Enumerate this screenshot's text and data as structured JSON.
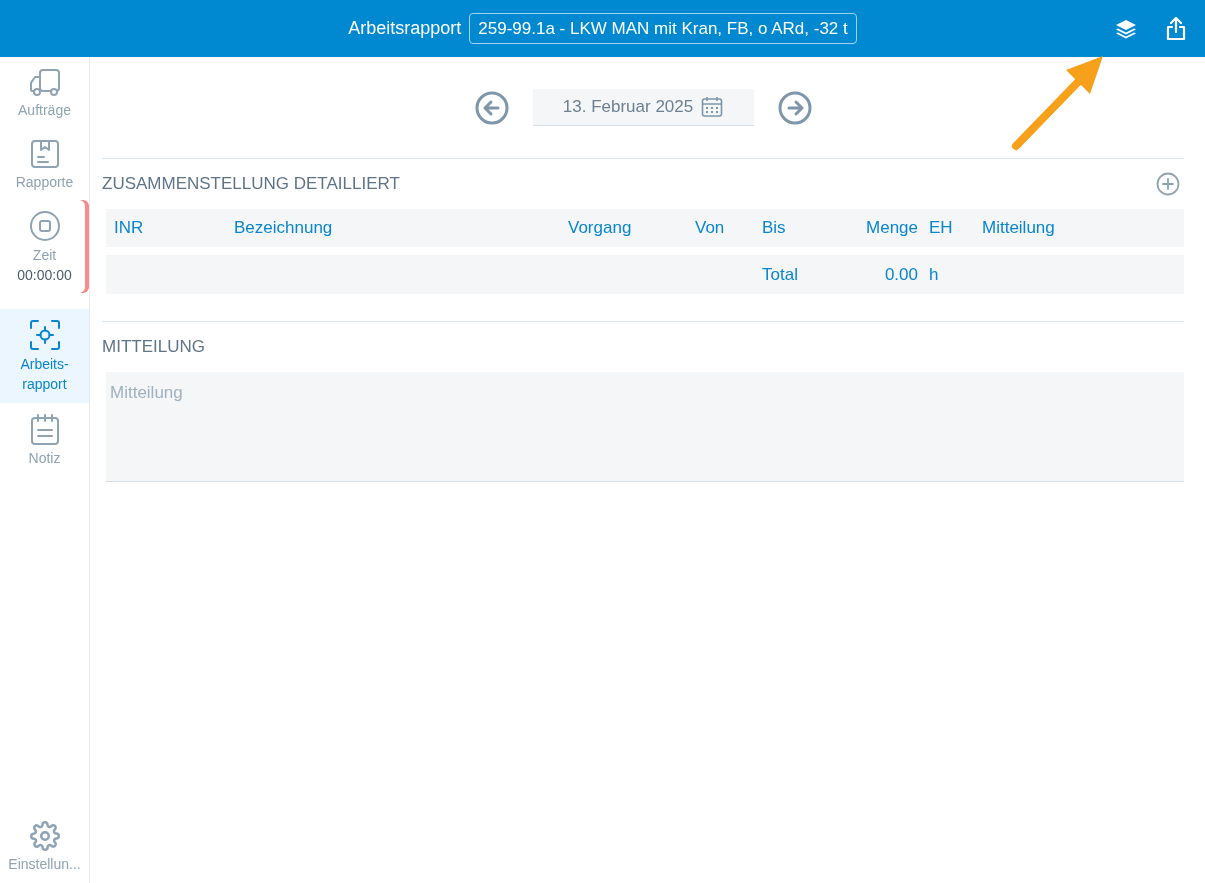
{
  "header": {
    "title": "Arbeitsrapport",
    "selector_value": "259-99.1a - LKW MAN mit Kran, FB, o ARd, -32 t"
  },
  "sidebar": {
    "items": [
      {
        "kind": "truck",
        "label": "Aufträge",
        "selected": false,
        "alert": false
      },
      {
        "kind": "report",
        "label": "Rapporte",
        "selected": false,
        "alert": false
      },
      {
        "kind": "timer",
        "label": "Zeit",
        "value": "00:00:00",
        "selected": false,
        "alert": true
      },
      {
        "kind": "focus",
        "label": "Arbeits-\nrapport",
        "selected": true,
        "alert": false
      },
      {
        "kind": "note",
        "label": "Notiz",
        "selected": false,
        "alert": false
      }
    ],
    "footer_item": {
      "kind": "gear",
      "label": "Einstellun..."
    }
  },
  "date_nav": {
    "date": "13. Februar 2025"
  },
  "summary": {
    "title": "ZUSAMMENSTELLUNG DETAILLIERT",
    "table": {
      "columns": [
        "INR",
        "Bezeichnung",
        "Vorgang",
        "Von",
        "Bis",
        "Menge",
        "EH",
        "Mitteilung"
      ],
      "total_row": {
        "label": "Total",
        "amount": "0.00",
        "unit": "h"
      }
    }
  },
  "message": {
    "title": "MITTEILUNG",
    "placeholder": "Mitteilung"
  },
  "annotation": {
    "kind": "arrow"
  }
}
